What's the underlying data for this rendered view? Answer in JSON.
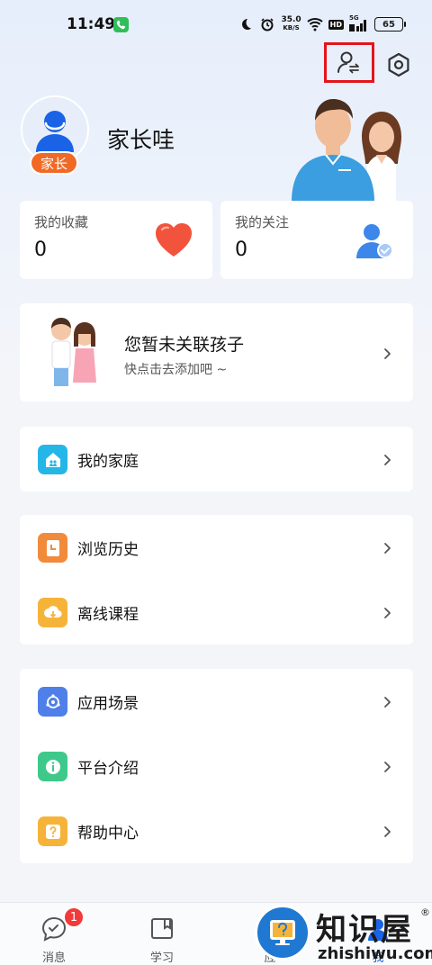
{
  "status_bar": {
    "time": "11:49",
    "net_speed_value": "35.0",
    "net_speed_unit": "KB/S",
    "hd": "HD",
    "network": "5G",
    "battery": "65"
  },
  "profile": {
    "name": "家长哇",
    "role": "家长"
  },
  "stats": {
    "favorites_label": "我的收藏",
    "favorites_count": "0",
    "following_label": "我的关注",
    "following_count": "0"
  },
  "child_card": {
    "title": "您暂未关联孩子",
    "subtitle": "快点击去添加吧 ~"
  },
  "menu": {
    "family": "我的家庭",
    "history": "浏览历史",
    "offline": "离线课程",
    "scenes": "应用场景",
    "intro": "平台介绍",
    "help": "帮助中心"
  },
  "tabbar": {
    "messages": "消息",
    "messages_badge": "1",
    "study": "学习",
    "app": "应",
    "me": "我"
  },
  "watermark": {
    "title": "知识屋",
    "url": "zhishiwu.com",
    "reg": "®"
  },
  "colors": {
    "accent_orange": "#f06a25",
    "highlight_red": "#e3141b",
    "brand_blue": "#1f78d1"
  }
}
